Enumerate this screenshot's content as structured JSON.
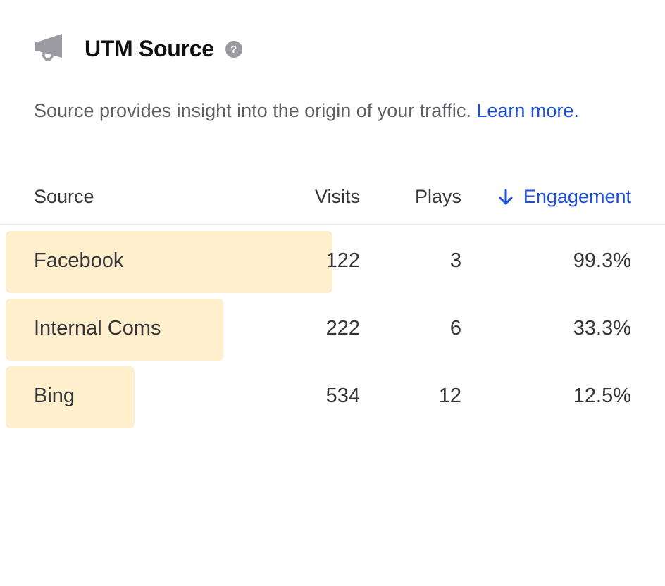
{
  "header": {
    "title": "UTM Source",
    "icon": "megaphone-icon",
    "help_icon": "question-circle-icon",
    "help_glyph": "?"
  },
  "description": {
    "text": "Source provides insight into the origin of your traffic. ",
    "link": "Learn more."
  },
  "table": {
    "columns": {
      "source": "Source",
      "visits": "Visits",
      "plays": "Plays",
      "engagement": "Engagement"
    },
    "sort": {
      "column": "engagement",
      "direction": "descending"
    },
    "rows": [
      {
        "source": "Facebook",
        "visits": "122",
        "plays": "3",
        "engagement": "99.3%",
        "bar_fraction": 0.99
      },
      {
        "source": "Internal Coms",
        "visits": "222",
        "plays": "6",
        "engagement": "33.3%",
        "bar_fraction": 0.66
      },
      {
        "source": "Bing",
        "visits": "534",
        "plays": "12",
        "engagement": "12.5%",
        "bar_fraction": 0.39
      }
    ]
  },
  "colors": {
    "accent": "#1d4ed8",
    "bar": "#ffefcc",
    "icon_gray": "#9a9aa0"
  }
}
